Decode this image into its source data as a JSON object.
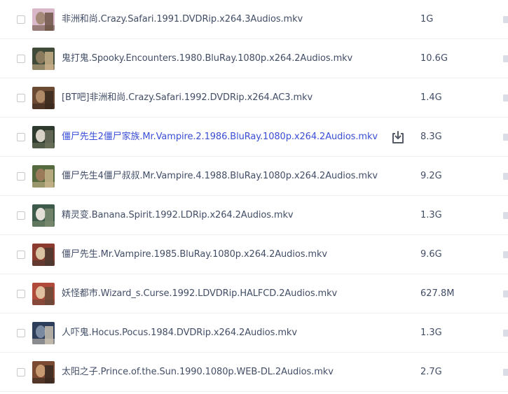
{
  "files": [
    {
      "name": "非洲和尚.Crazy.Safari.1991.DVDRip.x264.3Audios.mkv",
      "size": "1G",
      "thumb_colors": [
        "#d9b8c9",
        "#a58a7a",
        "#6d5546"
      ]
    },
    {
      "name": "鬼打鬼.Spooky.Encounters.1980.BluRay.1080p.x264.2Audios.mkv",
      "size": "10.6G",
      "thumb_colors": [
        "#3f4a38",
        "#8a7a5e",
        "#c9b08a"
      ]
    },
    {
      "name": "[BT吧]非洲和尚.Crazy.Safari.1992.DVDRip.x264.AC3.mkv",
      "size": "1.4G",
      "thumb_colors": [
        "#6b4a34",
        "#b08a66",
        "#3a2a20"
      ]
    },
    {
      "name": "僵尸先生2僵尸家族.Mr.Vampire.2.1986.BluRay.1080p.x264.2Audios.mkv",
      "size": "8.3G",
      "thumb_colors": [
        "#2f3a2e",
        "#d8d2c6",
        "#6a6f5a"
      ]
    },
    {
      "name": "僵尸先生4僵尸叔叔.Mr.Vampire.4.1988.BluRay.1080p.x264.2Audios.mkv",
      "size": "9.2G",
      "thumb_colors": [
        "#556b3f",
        "#9a7a58",
        "#c8b48c"
      ]
    },
    {
      "name": "精灵变.Banana.Spirit.1992.LDRip.x264.2Audios.mkv",
      "size": "1.3G",
      "thumb_colors": [
        "#3e5a4a",
        "#e4e0d8",
        "#7a8a70"
      ]
    },
    {
      "name": "僵尸先生.Mr.Vampire.1985.BluRay.1080p.x264.2Audios.mkv",
      "size": "9.6G",
      "thumb_colors": [
        "#8a3a2e",
        "#d8c2a2",
        "#4a3a30"
      ]
    },
    {
      "name": "妖怪都市.Wizard_s.Curse.1992.LDVDRip.HALFCD.2Audios.mkv",
      "size": "627.8M",
      "thumb_colors": [
        "#b04a3a",
        "#e0c0a0",
        "#6a4a3a"
      ]
    },
    {
      "name": "人吓鬼.Hocus.Pocus.1984.DVDRip.x264.2Audios.mkv",
      "size": "1.3G",
      "thumb_colors": [
        "#2e3e5a",
        "#7a8aa0",
        "#c8c0b0"
      ]
    },
    {
      "name": "太阳之子.Prince.of.the.Sun.1990.1080p.WEB-DL.2Audios.mkv",
      "size": "2.7G",
      "thumb_colors": [
        "#7a4a32",
        "#c89a72",
        "#3a2a22"
      ]
    }
  ],
  "hovered_index": 3,
  "download_icon": "download-tray-icon",
  "accent_color": "#3a4ed6"
}
